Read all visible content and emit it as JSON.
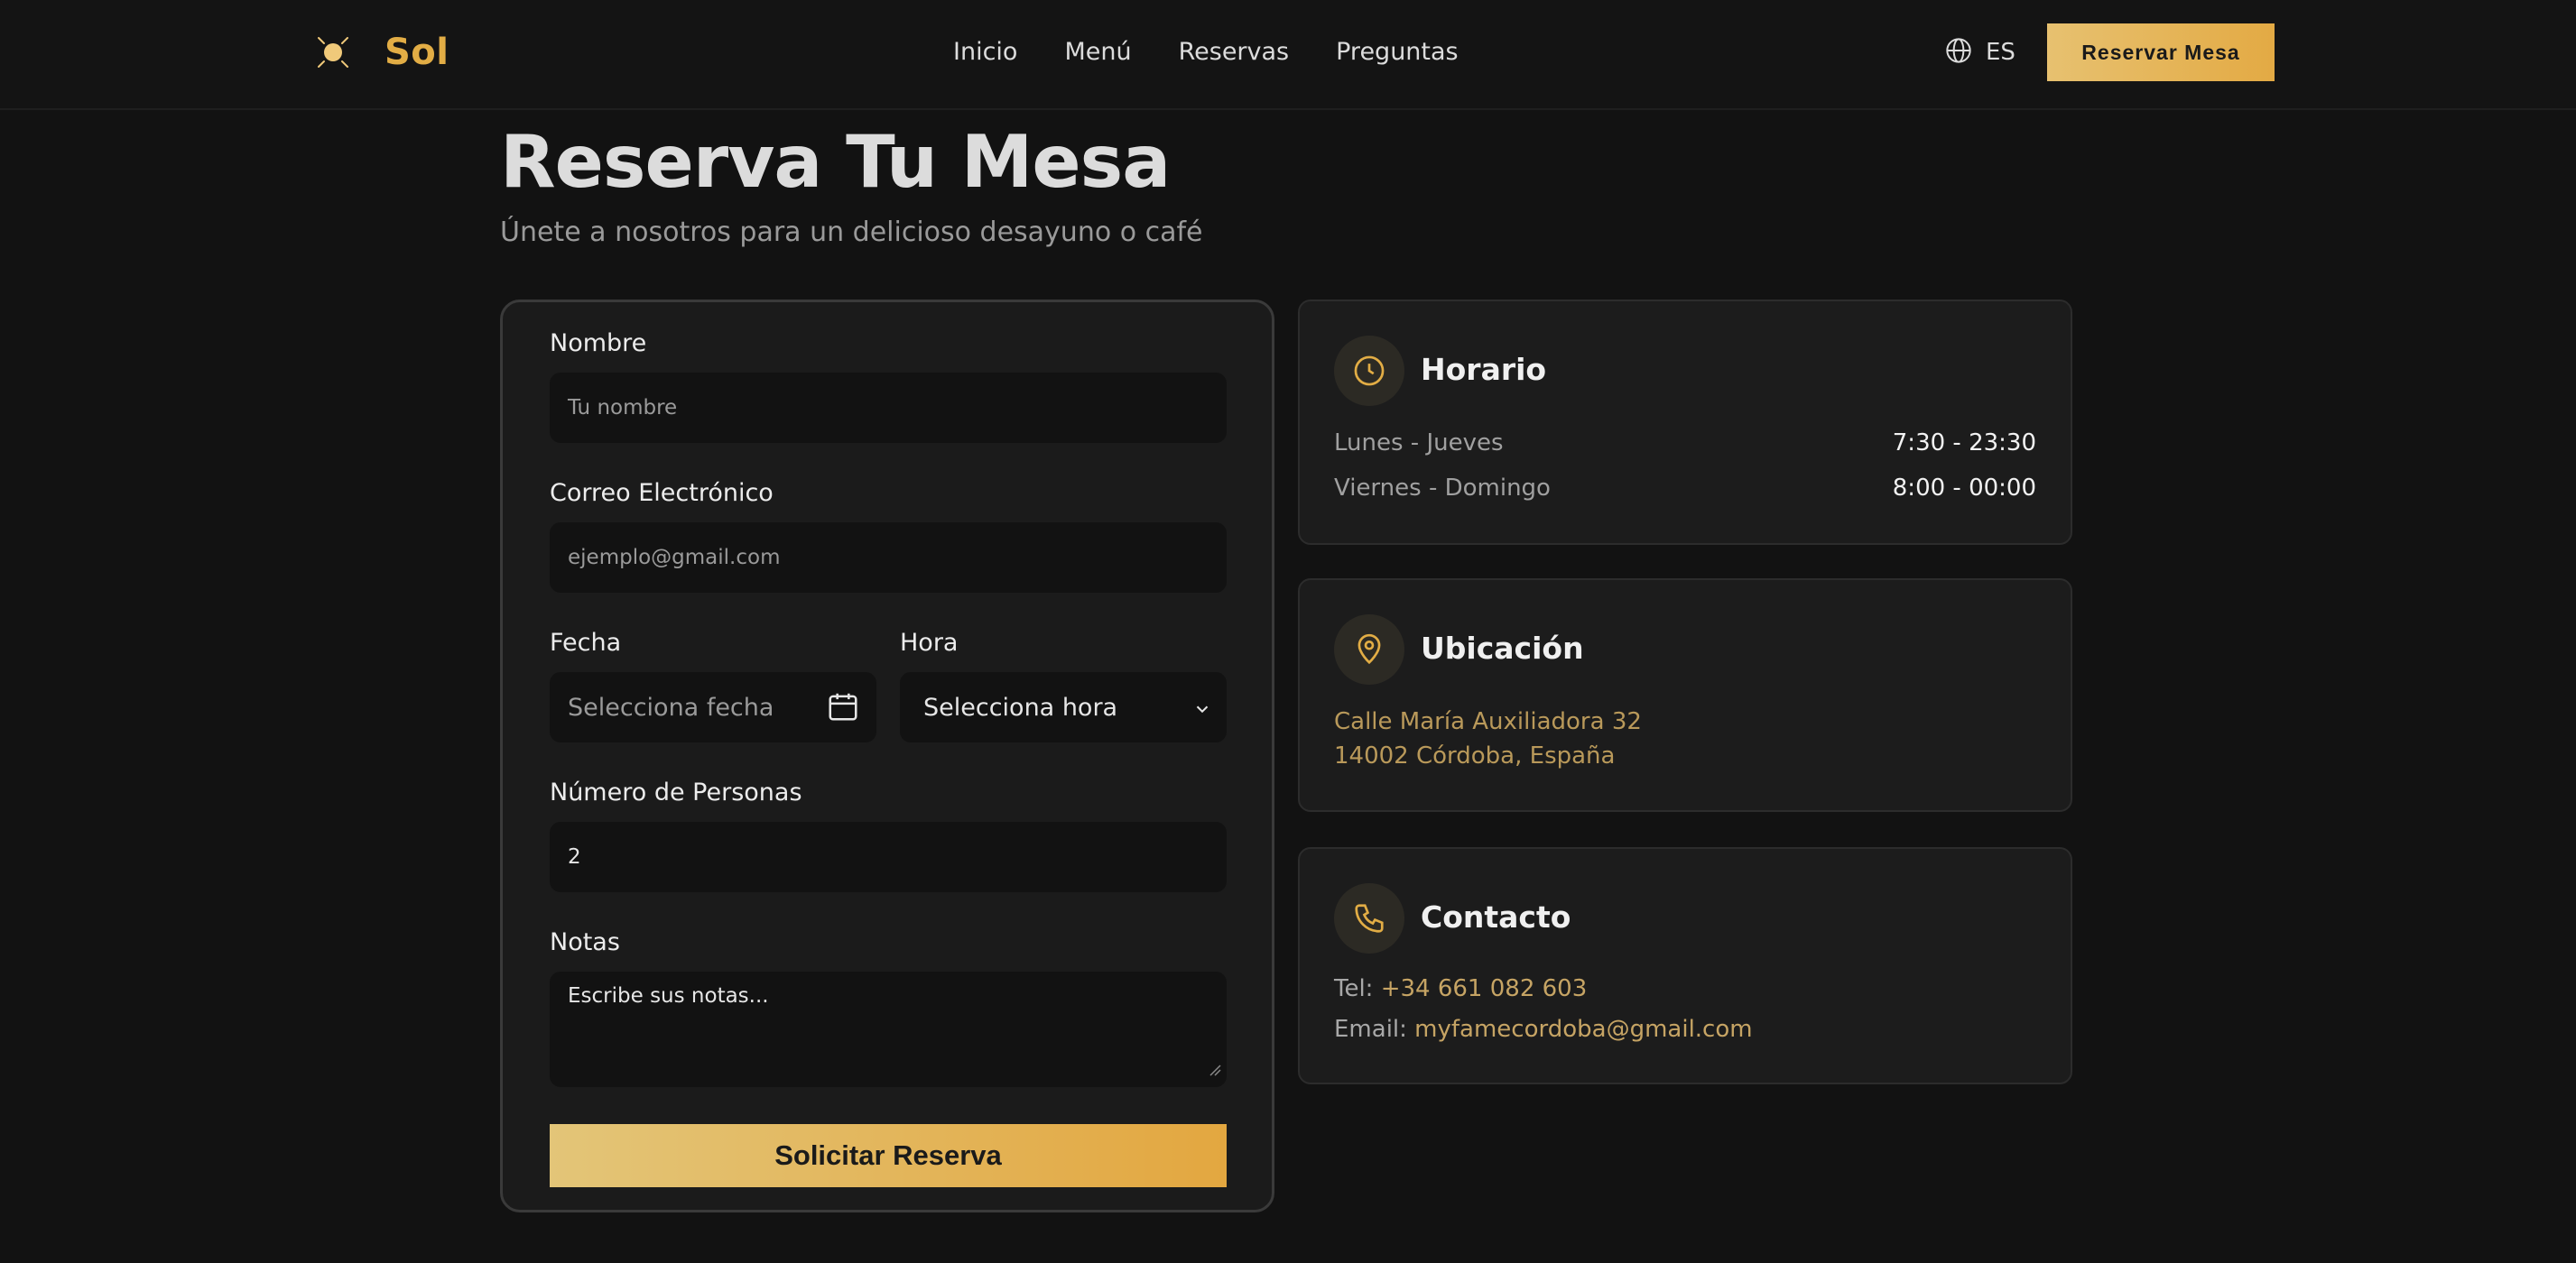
{
  "header": {
    "brand": "Sol",
    "nav": [
      "Inicio",
      "Menú",
      "Reservas",
      "Preguntas"
    ],
    "language": "ES",
    "cta": "Reservar Mesa"
  },
  "hero": {
    "title": "Reserva Tu Mesa",
    "subtitle": "Únete a nosotros para un delicioso desayuno o café"
  },
  "form": {
    "name_label": "Nombre",
    "name_placeholder": "Tu nombre",
    "email_label": "Correo Electrónico",
    "email_placeholder": "ejemplo@gmail.com",
    "date_label": "Fecha",
    "date_placeholder": "Selecciona fecha",
    "time_label": "Hora",
    "time_value": "Selecciona hora",
    "people_label": "Número de Personas",
    "people_value": "2",
    "notes_label": "Notas",
    "notes_placeholder": "Escribe sus notas...",
    "submit": "Solicitar Reserva"
  },
  "hours": {
    "title": "Horario",
    "rows": [
      {
        "day": "Lunes - Jueves",
        "time": "7:30 - 23:30"
      },
      {
        "day": "Viernes - Domingo",
        "time": "8:00 - 00:00"
      }
    ]
  },
  "location": {
    "title": "Ubicación",
    "line1": "Calle María Auxiliadora 32",
    "line2": "14002 Córdoba, España"
  },
  "contact": {
    "title": "Contacto",
    "tel_label": "Tel:",
    "tel": "+34 661 082 603",
    "email_label": "Email:",
    "email": "myfamecordoba@gmail.com"
  },
  "colors": {
    "accent": "#e2ad45",
    "background": "#121212",
    "card": "#1c1c1c"
  }
}
